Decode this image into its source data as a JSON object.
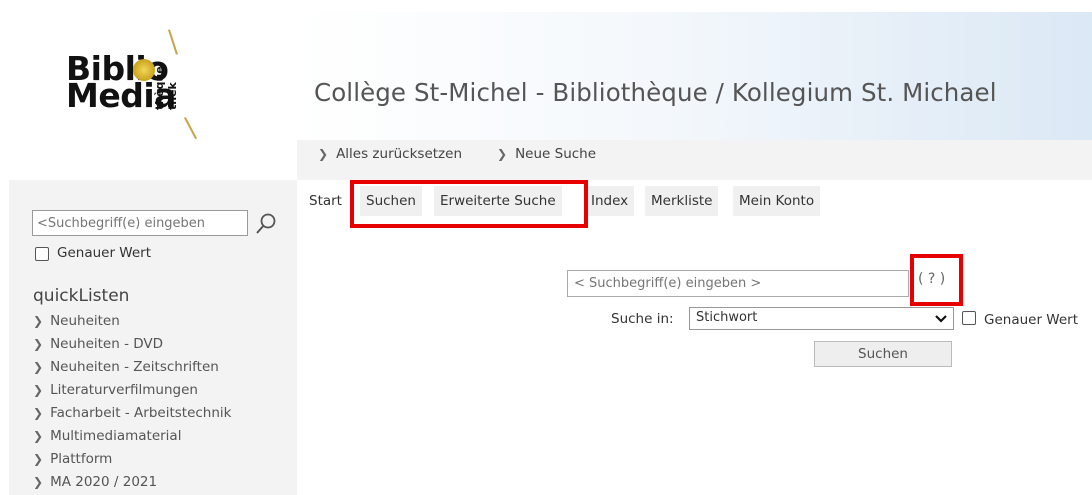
{
  "logo": {
    "line1": "Biblio",
    "line2": "Media",
    "vertical1": "thèque",
    "vertical2": "thek"
  },
  "header": {
    "title": "Collège St-Michel - Bibliothèque / Kollegium St. Michael"
  },
  "breadcrumb": {
    "items": [
      "Alles zurücksetzen",
      "Neue Suche"
    ]
  },
  "tabs": [
    "Start",
    "Suchen",
    "Erweiterte Suche",
    "Index",
    "Merkliste",
    "Mein Konto"
  ],
  "sidebar": {
    "search_placeholder": "<Suchbegriff(e) eingeben",
    "exact_label": "Genauer Wert",
    "quicklists_title": "quickListen",
    "quicklists": [
      "Neuheiten",
      "Neuheiten - DVD",
      "Neuheiten - Zeitschriften",
      "Literaturverfilmungen",
      "Facharbeit - Arbeitstechnik",
      "Multimediamaterial",
      "Plattform",
      "MA 2020 / 2021"
    ]
  },
  "main": {
    "search_placeholder": "< Suchbegriff(e) eingeben >",
    "help_text": "( ? )",
    "search_in_label": "Suche in:",
    "search_in_value": "Stichwort",
    "exact_label": "Genauer Wert",
    "search_button": "Suchen"
  },
  "colors": {
    "highlight": "#e60000",
    "logo_gold": "#c9a21a"
  }
}
